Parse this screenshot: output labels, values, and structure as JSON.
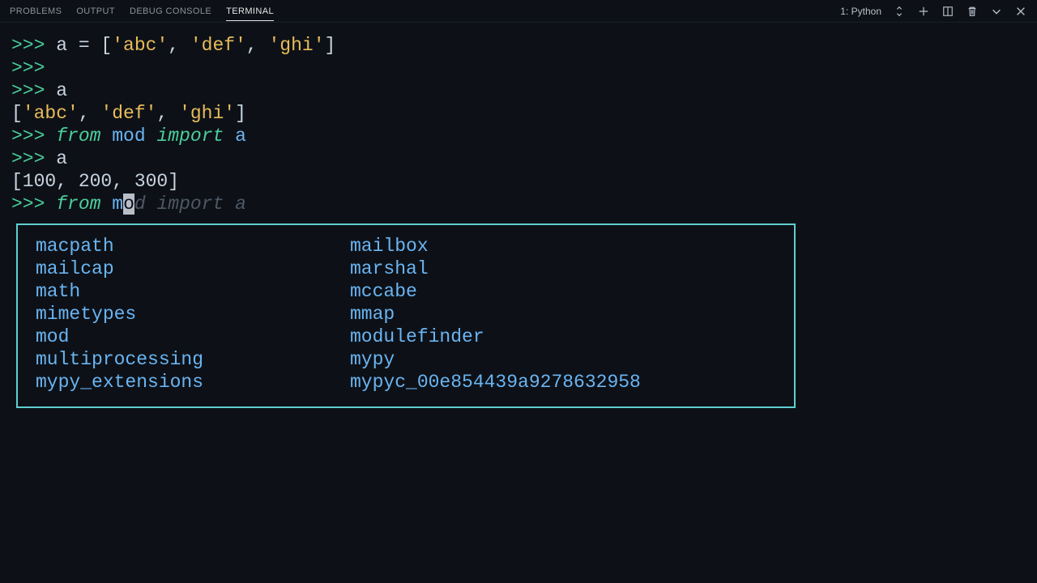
{
  "panel": {
    "tabs": {
      "problems": "PROBLEMS",
      "output": "OUTPUT",
      "debug": "DEBUG CONSOLE",
      "terminal": "TERMINAL"
    },
    "selector_label": "1: Python"
  },
  "terminal": {
    "l1_prompt": ">>> ",
    "l1_a": "a = [",
    "l1_s1": "'abc'",
    "l1_c1": ", ",
    "l1_s2": "'def'",
    "l1_c2": ", ",
    "l1_s3": "'ghi'",
    "l1_b": "]",
    "l2_prompt": ">>>",
    "l3_prompt": ">>> ",
    "l3_a": "a",
    "l4_a": "[",
    "l4_s1": "'abc'",
    "l4_c1": ", ",
    "l4_s2": "'def'",
    "l4_c2": ", ",
    "l4_s3": "'ghi'",
    "l4_b": "]",
    "l5_prompt": ">>> ",
    "l5_kw1": "from",
    "l5_sp1": " ",
    "l5_mod": "mod",
    "l5_sp2": " ",
    "l5_kw2": "import",
    "l5_sp3": " ",
    "l5_id": "a",
    "l6_prompt": ">>> ",
    "l6_a": "a",
    "l7": "[100, 200, 300]",
    "l8_prompt": ">>> ",
    "l8_kw1": "from",
    "l8_sp1": " ",
    "l8_typed_m": "m",
    "l8_cursorchar": "o",
    "l8_ghost": "d import a"
  },
  "suggestions": {
    "r0a": "macpath",
    "r0b": "mailbox",
    "r1a": "mailcap",
    "r1b": "marshal",
    "r2a": "math",
    "r2b": "mccabe",
    "r3a": "mimetypes",
    "r3b": "mmap",
    "r4a": "mod",
    "r4b": "modulefinder",
    "r5a": "multiprocessing",
    "r5b": "mypy",
    "r6a": "mypy_extensions",
    "r6b": "mypyc_00e854439a9278632958"
  }
}
